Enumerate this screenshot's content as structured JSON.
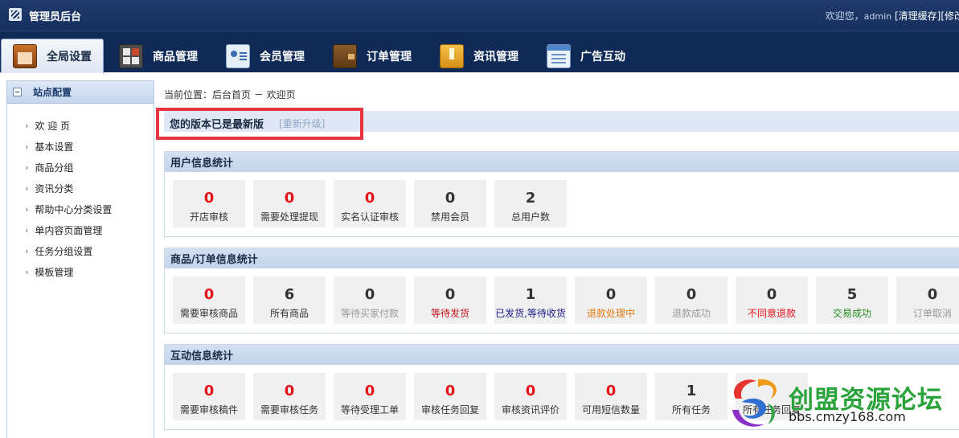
{
  "app": {
    "title": "管理员后台",
    "logo_icon": "admin-logo-icon"
  },
  "topbar": {
    "welcome": "欢迎您，",
    "user": "admin",
    "clear_cache": "[清理缓存]",
    "modify": "[修改"
  },
  "nav": {
    "tabs": [
      {
        "label": "全局设置",
        "icon": "home-icon",
        "active": true
      },
      {
        "label": "商品管理",
        "icon": "grid-icon",
        "active": false
      },
      {
        "label": "会员管理",
        "icon": "member-card-icon",
        "active": false
      },
      {
        "label": "订单管理",
        "icon": "wallet-icon",
        "active": false
      },
      {
        "label": "资讯管理",
        "icon": "news-icon",
        "active": false
      },
      {
        "label": "广告互动",
        "icon": "ad-icon",
        "active": false
      }
    ]
  },
  "sidebar": {
    "title": "站点配置",
    "items": [
      {
        "label": "欢 迎 页"
      },
      {
        "label": "基本设置"
      },
      {
        "label": "商品分组"
      },
      {
        "label": "资讯分类"
      },
      {
        "label": "帮助中心分类设置"
      },
      {
        "label": "单内容页面管理"
      },
      {
        "label": "任务分组设置"
      },
      {
        "label": "模板管理"
      }
    ]
  },
  "breadcrumb": "当前位置：后台首页 － 欢迎页",
  "version": {
    "text": "您的版本已是最新版",
    "link": "[重新升级]"
  },
  "sections": {
    "user": {
      "title": "用户信息统计",
      "stats": [
        {
          "value": "0",
          "label": "开店审核"
        },
        {
          "value": "0",
          "label": "需要处理提现"
        },
        {
          "value": "0",
          "label": "实名认证审核"
        },
        {
          "value": "0",
          "label": "禁用会员"
        },
        {
          "value": "2",
          "label": "总用户数"
        }
      ]
    },
    "goods": {
      "title": "商品/订单信息统计",
      "stats": [
        {
          "value": "0",
          "label": "需要审核商品"
        },
        {
          "value": "6",
          "label": "所有商品"
        },
        {
          "value": "0",
          "label": "等待买家付款"
        },
        {
          "value": "0",
          "label": "等待发货"
        },
        {
          "value": "1",
          "label": "已发货,等待收货"
        },
        {
          "value": "0",
          "label": "退款处理中"
        },
        {
          "value": "0",
          "label": "退款成功"
        },
        {
          "value": "0",
          "label": "不同意退款"
        },
        {
          "value": "5",
          "label": "交易成功"
        },
        {
          "value": "0",
          "label": "订单取消"
        }
      ]
    },
    "interact": {
      "title": "互动信息统计",
      "stats": [
        {
          "value": "0",
          "label": "需要审核稿件"
        },
        {
          "value": "0",
          "label": "需要审核任务"
        },
        {
          "value": "0",
          "label": "等待受理工单"
        },
        {
          "value": "0",
          "label": "审核任务回复"
        },
        {
          "value": "0",
          "label": "审核资讯评价"
        },
        {
          "value": "0",
          "label": "可用短信数量"
        },
        {
          "value": "1",
          "label": "所有任务"
        },
        {
          "value": "",
          "label": "所有任务回复"
        }
      ]
    }
  },
  "watermark": {
    "name": "创盟资源论坛",
    "url": "bbs.cmzy168.com"
  },
  "colors": {
    "red_value": "#e5141b",
    "gray_label": "#999999",
    "wait_ship": "#c4141b",
    "shipped": "#1a1a8c",
    "refunding": "#e07a10",
    "refused": "#e5141b",
    "success": "#1f8a1f",
    "highlight": "#e8343f"
  }
}
